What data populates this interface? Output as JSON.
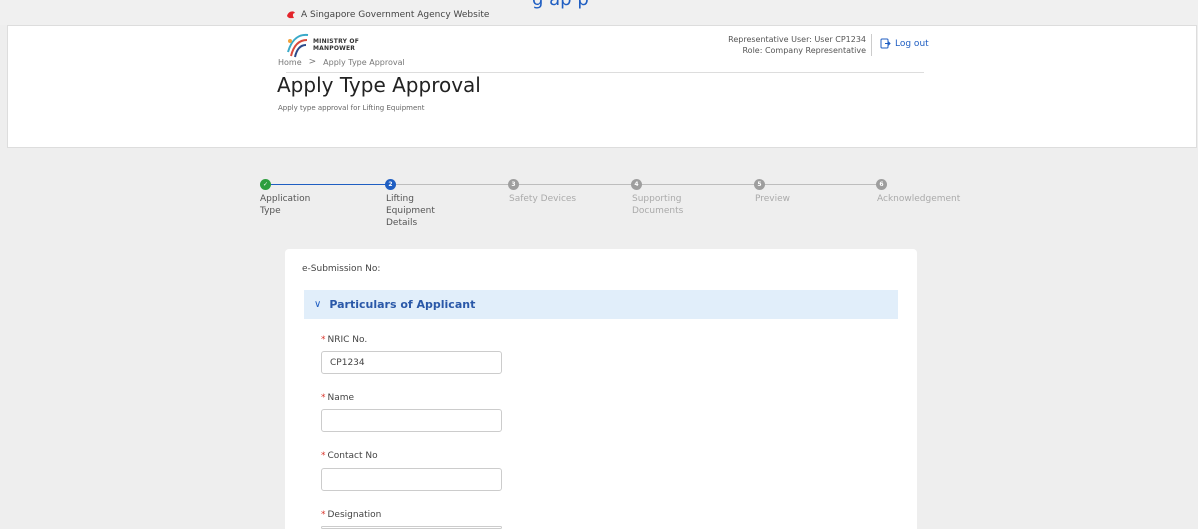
{
  "gov_bar": {
    "text": "A Singapore Government Agency Website",
    "cut_text": "g   ap   p"
  },
  "header": {
    "logo_line1": "MINISTRY OF",
    "logo_line2": "MANPOWER",
    "user_line1": "Representative User: User CP1234",
    "user_line2": "Role: Company Representative",
    "logout_label": "Log out"
  },
  "breadcrumb": {
    "home": "Home",
    "separator": ">",
    "current": "Apply Type Approval"
  },
  "page": {
    "title": "Apply Type Approval",
    "subtitle": "Apply type approval for Lifting Equipment"
  },
  "stepper": {
    "steps": [
      {
        "number": "1",
        "label_l1": "Application",
        "label_l2": "Type",
        "label_l3": "",
        "state": "done"
      },
      {
        "number": "2",
        "label_l1": "Lifting",
        "label_l2": "Equipment",
        "label_l3": "Details",
        "state": "active"
      },
      {
        "number": "3",
        "label_l1": "Safety Devices",
        "label_l2": "",
        "label_l3": "",
        "state": "pending"
      },
      {
        "number": "4",
        "label_l1": "Supporting",
        "label_l2": "Documents",
        "label_l3": "",
        "state": "pending"
      },
      {
        "number": "5",
        "label_l1": "Preview",
        "label_l2": "",
        "label_l3": "",
        "state": "pending"
      },
      {
        "number": "6",
        "label_l1": "Acknowledgement",
        "label_l2": "",
        "label_l3": "",
        "state": "pending"
      }
    ]
  },
  "form": {
    "esubmission_label": "e-Submission No:",
    "section_title": "Particulars of Applicant",
    "required_mark": "*",
    "fields": [
      {
        "label": "NRIC No.",
        "value": "CP1234"
      },
      {
        "label": "Name",
        "value": ""
      },
      {
        "label": "Contact No",
        "value": ""
      },
      {
        "label": "Designation",
        "value": ""
      }
    ]
  },
  "colors": {
    "accent": "#1f5ec2",
    "done": "#2e9e3e",
    "pending": "#9e9e9e",
    "required": "#d9352b",
    "section_bg": "#e1eefa"
  }
}
